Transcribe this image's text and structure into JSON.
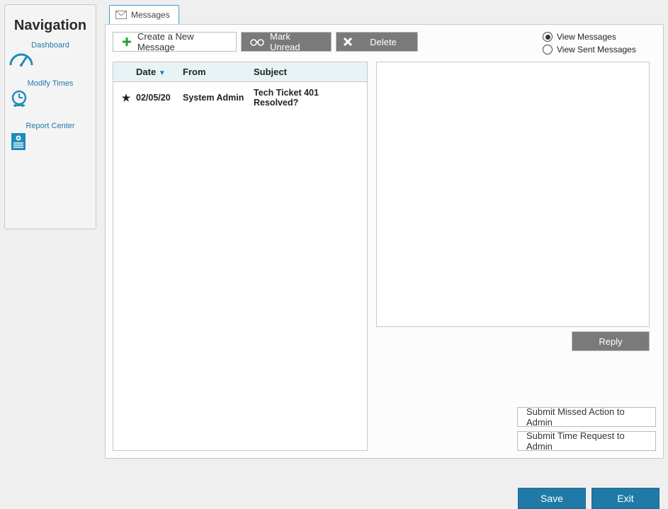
{
  "sidebar": {
    "title": "Navigation",
    "items": [
      {
        "label": "Dashboard"
      },
      {
        "label": "Modify Times"
      },
      {
        "label": "Report Center"
      }
    ]
  },
  "tab": {
    "label": "Messages"
  },
  "toolbar": {
    "create_label": "Create a New Message",
    "mark_label": "Mark Unread",
    "delete_label": "Delete"
  },
  "view": {
    "messages_label": "View Messages",
    "sent_label": "View Sent Messages",
    "selected": "messages"
  },
  "columns": {
    "date": "Date",
    "from": "From",
    "subject": "Subject"
  },
  "messages": [
    {
      "starred": true,
      "date": "02/05/20",
      "from": "System Admin",
      "subject": "Tech Ticket 401 Resolved?"
    }
  ],
  "actions": {
    "reply": "Reply",
    "missed": "Submit Missed Action to Admin",
    "timereq": "Submit Time Request to Admin",
    "save": "Save",
    "exit": "Exit"
  }
}
